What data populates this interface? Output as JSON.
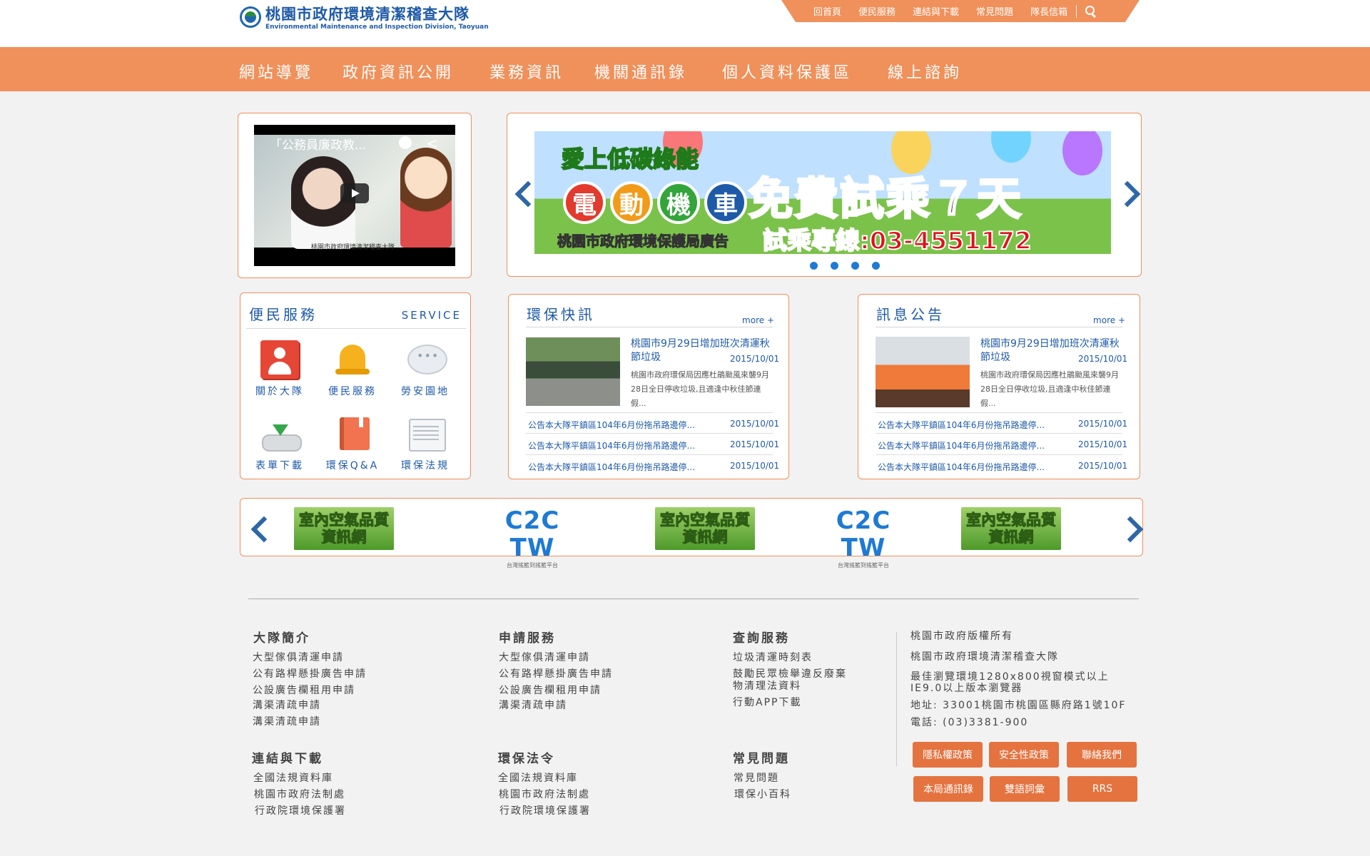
{
  "header": {
    "logo_zh": "桃園市政府環境清潔稽查大隊",
    "logo_en": "Environmental Maintenance and Inspection Division, Taoyuan",
    "top_links": [
      "回首頁",
      "便民服務",
      "連結與下載",
      "常見問題",
      "隊長信箱"
    ]
  },
  "main_nav": [
    "網站導覽",
    "政府資訊公開",
    "業務資訊",
    "機關通訊錄",
    "個人資料保護區",
    "線上諮詢"
  ],
  "video": {
    "title": "「公務員廉政教...",
    "caption": "桃園市政府環境清潔稽查大隊"
  },
  "banner": {
    "tagline": "愛上低碳綠能",
    "circles": [
      "電",
      "動",
      "機",
      "車"
    ],
    "headline": "免費試乘７天",
    "agency": "桃園市政府環境保護局廣告",
    "hotline": "試乘專線:03-4551172",
    "dot_count": 4
  },
  "services": {
    "title": "便民服務",
    "title_en": "SERVICE",
    "items": [
      "關於大隊",
      "便民服務",
      "勞安園地",
      "表單下載",
      "環保Q&A",
      "環保法規"
    ]
  },
  "env_news": {
    "title": "環保快訊",
    "more": "more +",
    "featured": {
      "headline": "桃園市9月29日增加班次清運秋節垃圾",
      "date": "2015/10/01",
      "summary": "桃園市政府環保局因應杜鵑颱風來襲9月28日全日停收垃圾,且適逢中秋佳節連假..."
    },
    "list": [
      {
        "text": "公告本大隊平鎮區104年6月份拖吊路邊停...",
        "date": "2015/10/01"
      },
      {
        "text": "公告本大隊平鎮區104年6月份拖吊路邊停...",
        "date": "2015/10/01"
      },
      {
        "text": "公告本大隊平鎮區104年6月份拖吊路邊停...",
        "date": "2015/10/01"
      }
    ]
  },
  "announcements": {
    "title": "訊息公告",
    "more": "more +",
    "featured": {
      "headline": "桃園市9月29日增加班次清運秋節垃圾",
      "date": "2015/10/01",
      "summary": "桃園市政府環保局因應杜鵑颱風來襲9月28日全日停收垃圾,且適逢中秋佳節連假..."
    },
    "list": [
      {
        "text": "公告本大隊平鎮區104年6月份拖吊路邊停...",
        "date": "2015/10/01"
      },
      {
        "text": "公告本大隊平鎮區104年6月份拖吊路邊停...",
        "date": "2015/10/01"
      },
      {
        "text": "公告本大隊平鎮區104年6月份拖吊路邊停...",
        "date": "2015/10/01"
      }
    ]
  },
  "link_logos": {
    "iaq": [
      "室內空氣品質",
      "資訊網"
    ],
    "c2c": "C2C TW",
    "c2c_sub": "台灣搖籃到搖籃平台"
  },
  "footer": {
    "col1": {
      "head": "大隊簡介",
      "items": [
        "大型傢俱清運申請",
        "公有路桿懸掛廣告申請",
        "公設廣告欄租用申請",
        "溝渠清疏申請",
        "溝渠清疏申請"
      ]
    },
    "col2": {
      "head": "申請服務",
      "items": [
        "大型傢俱清運申請",
        "公有路桿懸掛廣告申請",
        "公設廣告欄租用申請",
        "溝渠清疏申請"
      ]
    },
    "col3": {
      "head": "查詢服務",
      "items": [
        "垃圾清運時刻表",
        "鼓勵民眾檢舉違反廢棄",
        "物清理法資料",
        "行動APP下載"
      ]
    },
    "col4": {
      "head": "連結與下載",
      "items": [
        "全國法規資料庫",
        "桃園市政府法制處",
        "行政院環境保護署"
      ]
    },
    "col5": {
      "head": "環保法令",
      "items": [
        "全國法規資料庫",
        "桃園市政府法制處",
        "行政院環境保護署"
      ]
    },
    "col6": {
      "head": "常見問題",
      "items": [
        "常見問題",
        "環保小百科"
      ]
    },
    "info": [
      "桃園市政府版權所有",
      "桃園市政府環境清潔稽查大隊",
      "最佳瀏覽環境1280x800視窗模式以上",
      "IE9.0以上版本瀏覽器",
      "地址: 33001桃園市桃園區縣府路1號10F",
      "電話: (03)3381-900"
    ],
    "buttons": [
      "隱私權政策",
      "安全性政策",
      "聯絡我們",
      "本局通訊錄",
      "雙語詞彙",
      "RRS"
    ]
  },
  "colors": {
    "accent": "#f0905a",
    "brand_blue": "#1e5aa8",
    "button": "#e4733f"
  }
}
